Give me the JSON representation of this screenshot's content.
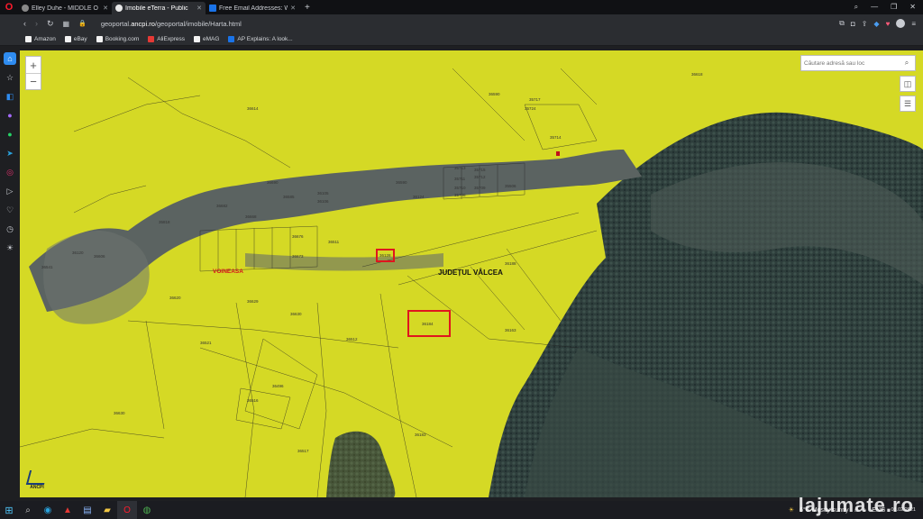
{
  "browser": {
    "tabs": [
      {
        "title": "Elley Duhe - MIDDLE O",
        "active": false,
        "favicon_color": "#888888"
      },
      {
        "title": "Imobile eTerra - Public",
        "active": true,
        "favicon_color": "#e8e8e8"
      },
      {
        "title": "Free Email Addresses: Web",
        "active": false,
        "favicon_color": "#1a73e8"
      }
    ],
    "new_tab_label": "+",
    "url_prefix": "geoportal.",
    "url_domain": "ancpi.ro",
    "url_path": "/geoportal/imobile/Harta.html",
    "bookmarks": [
      {
        "label": "Amazon",
        "color": "#f3f3f3"
      },
      {
        "label": "eBay",
        "color": "#f3f3f3"
      },
      {
        "label": "Booking.com",
        "color": "#f3f3f3"
      },
      {
        "label": "AliExpress",
        "color": "#e53935"
      },
      {
        "label": "eMAG",
        "color": "#f3f3f3"
      },
      {
        "label": "AP Explains: A look...",
        "color": "#1a73e8"
      }
    ]
  },
  "map": {
    "search_placeholder": "Căutare adresă sau loc",
    "zoom_in": "+",
    "zoom_out": "−",
    "locality_label": "VOINEASA",
    "county_label": "JUDEȚUL VÂLCEA",
    "logo_text": "ANCPI",
    "highlight_small_parcel": "36128",
    "highlight_large_parcel": "36184",
    "parcels": [
      {
        "id": "36614"
      },
      {
        "id": "36618"
      },
      {
        "id": "36590"
      },
      {
        "id": "35717"
      },
      {
        "id": "35724"
      },
      {
        "id": "35714"
      },
      {
        "id": "35713"
      },
      {
        "id": "35715"
      },
      {
        "id": "35712"
      },
      {
        "id": "35711"
      },
      {
        "id": "35710"
      },
      {
        "id": "35709"
      },
      {
        "id": "35708"
      },
      {
        "id": "36590"
      },
      {
        "id": "36124"
      },
      {
        "id": "35506"
      },
      {
        "id": "36105"
      },
      {
        "id": "36106"
      },
      {
        "id": "36690"
      },
      {
        "id": "36585"
      },
      {
        "id": "36682"
      },
      {
        "id": "36668"
      },
      {
        "id": "35818"
      },
      {
        "id": "36120"
      },
      {
        "id": "36606"
      },
      {
        "id": "36541"
      },
      {
        "id": "36676"
      },
      {
        "id": "36673"
      },
      {
        "id": "36511"
      },
      {
        "id": "36188"
      },
      {
        "id": "36620"
      },
      {
        "id": "36629"
      },
      {
        "id": "36630"
      },
      {
        "id": "36521"
      },
      {
        "id": "36512"
      },
      {
        "id": "36163"
      },
      {
        "id": "36496"
      },
      {
        "id": "36516"
      },
      {
        "id": "36630"
      },
      {
        "id": "36517"
      },
      {
        "id": "36183"
      }
    ]
  },
  "taskbar": {
    "weather": "6°C  Mostly sunny",
    "lang": "ENG",
    "time": "",
    "date": "03.02.2021"
  },
  "watermark": "lajumate.ro"
}
